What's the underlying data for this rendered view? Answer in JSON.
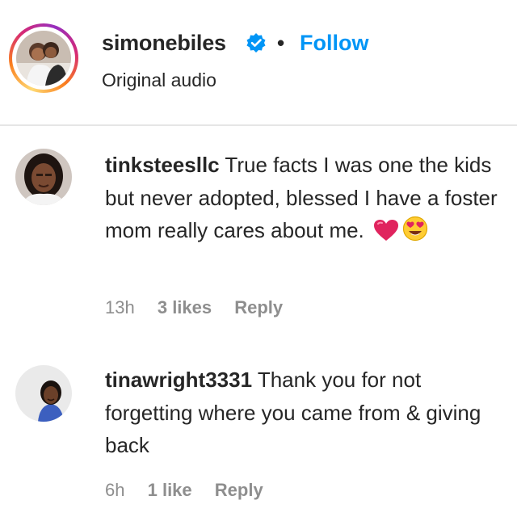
{
  "post": {
    "username": "simonebiles",
    "separator": "•",
    "follow_label": "Follow",
    "audio_label": "Original audio",
    "verified_icon": "verified-badge-icon"
  },
  "colors": {
    "link_blue": "#0095f6",
    "text": "#262626",
    "muted": "#8e8e8e",
    "heart": "#e0245e"
  },
  "comments": [
    {
      "username": "tinksteesllc",
      "text": "True facts I was one the kids but never adopted, blessed I have a foster mom really cares about me.",
      "emojis": [
        "red-heart-icon",
        "heart-eyes-face-icon"
      ],
      "time": "13h",
      "likes": "3 likes",
      "reply_label": "Reply"
    },
    {
      "username": "tinawright3331",
      "text": "Thank you for not forgetting where you came from & giving back",
      "emojis": [],
      "time": "6h",
      "likes": "1 like",
      "reply_label": "Reply"
    }
  ]
}
